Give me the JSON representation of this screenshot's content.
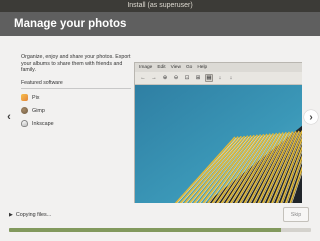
{
  "window": {
    "title": "Install (as superuser)"
  },
  "header": {
    "title": "Manage your photos"
  },
  "slide": {
    "description": "Organize, enjoy and share your photos. Export your albums to share them with friends and family.",
    "featured_label": "Featured software",
    "apps": [
      {
        "name": "Pix",
        "icon": "pix-icon"
      },
      {
        "name": "Gimp",
        "icon": "gimp-icon"
      },
      {
        "name": "Inkscape",
        "icon": "inkscape-icon"
      }
    ],
    "screenshot_menu": [
      "Image",
      "Edit",
      "View",
      "Go",
      "Help"
    ],
    "screenshot_tools": [
      "←",
      "→",
      "⊕",
      "⊖",
      "⊡",
      "⊞",
      "▦",
      "↓",
      "↓"
    ]
  },
  "footer": {
    "status_text": "Copying files...",
    "skip_label": "Skip",
    "progress": 0.9
  },
  "colors": {
    "titlebar": "#3c3b37",
    "header": "#5f5f5f",
    "progress": "#82995d"
  }
}
